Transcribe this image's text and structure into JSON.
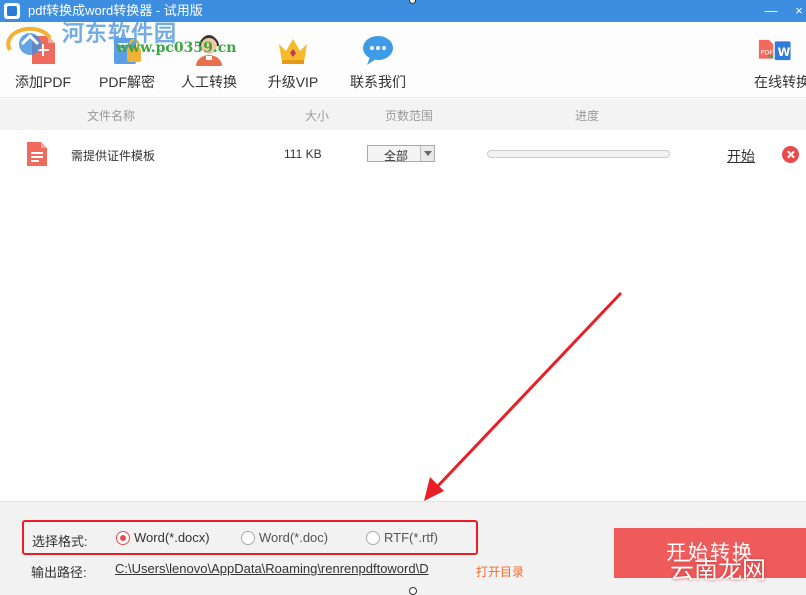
{
  "window": {
    "title": "pdf转换成word转换器 - 试用版",
    "minimize": "—",
    "close": "×"
  },
  "watermark": {
    "name": "河东软件园",
    "url": "www.pc0359.cn"
  },
  "toolbar": {
    "add_pdf": "添加PDF",
    "pdf_decrypt": "PDF解密",
    "manual_convert": "人工转换",
    "upgrade_vip": "升级VIP",
    "contact_us": "联系我们",
    "online_convert": "在线转换"
  },
  "columns": {
    "name": "文件名称",
    "size": "大小",
    "pages": "页数范围",
    "progress": "进度"
  },
  "files": [
    {
      "name": "需提供证件模板",
      "size": "111 KB",
      "pages": "全部",
      "progress": 0,
      "action": "开始"
    }
  ],
  "format": {
    "label": "选择格式:",
    "options": [
      "Word(*.docx)",
      "Word(*.doc)",
      "RTF(*.rtf)"
    ],
    "selected": "Word(*.docx)"
  },
  "output": {
    "label": "输出路径:",
    "path": "C:\\Users\\lenovo\\AppData\\Roaming\\renrenpdftoword\\D",
    "open_dir": "打开目录"
  },
  "convert_button": "开始转换",
  "site_mark": "云南龙网",
  "colors": {
    "titlebar": "#3d8ee0",
    "accent_red": "#e84b4b",
    "convert_button": "#ef5b5b",
    "annotation": "#e81f24",
    "open_dir": "#ef6b2d"
  }
}
